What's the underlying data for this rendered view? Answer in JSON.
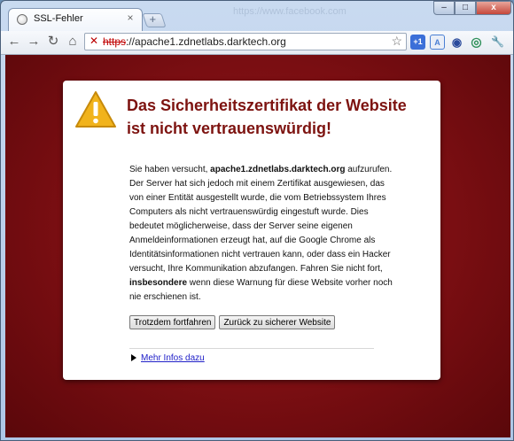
{
  "tab": {
    "title": "SSL-Fehler"
  },
  "background_tab_url": "https://www.facebook.com",
  "address_bar": {
    "protocol": "https",
    "rest": "://apache1.zdnetlabs.darktech.org"
  },
  "window_controls": {
    "minimize": "–",
    "maximize": "□",
    "close": "x"
  },
  "extensions": [
    {
      "name": "plus-one-extension",
      "label": "+1",
      "color": "#3b6fd8"
    },
    {
      "name": "translate-extension",
      "label": "A",
      "color": "#4a7fd4"
    },
    {
      "name": "shield-extension",
      "label": "◉",
      "color": "#2a4a9c"
    },
    {
      "name": "eye-extension",
      "label": "◎",
      "color": "#2f8f5a"
    },
    {
      "name": "wrench-menu",
      "label": "🔧",
      "color": "#666666"
    }
  ],
  "page": {
    "heading": "Das Sicherheitszertifikat der Website ist nicht vertrauenswürdig!",
    "para_1": "Sie haben versucht, ",
    "host_bold": "apache1.zdnetlabs.darktech.org",
    "para_2": " aufzurufen. Der Server hat sich jedoch mit einem Zertifikat ausgewiesen, das von einer Entität ausgestellt wurde, die vom Betriebssystem Ihres Computers als nicht vertrauenswürdig eingestuft wurde. Dies bedeutet möglicherweise, dass der Server seine eigenen Anmeldeinformationen erzeugt hat, auf die Google Chrome als Identitätsinformationen nicht vertrauen kann, oder dass ein Hacker versucht, Ihre Kommunikation abzufangen. Fahren Sie nicht fort, ",
    "emph_bold": "insbesondere",
    "para_3": " wenn diese Warnung für diese Website vorher noch nie erschienen ist.",
    "proceed_button": "Trotzdem fortfahren",
    "back_button": "Zurück zu sicherer Website",
    "more_info_link": "Mehr Infos dazu"
  },
  "colors": {
    "page_background": "#7a0e12",
    "heading": "#7d1310",
    "link": "#2020c8"
  }
}
